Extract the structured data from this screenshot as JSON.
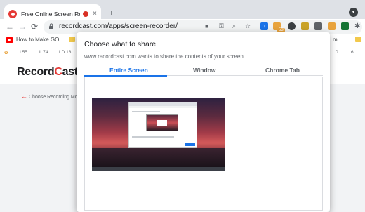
{
  "browser": {
    "tab": {
      "title": "Free Online Screen Recorder",
      "close": "×"
    },
    "new_tab": "+",
    "url": "recordcast.com/apps/screen-recorder/",
    "nav": {
      "back": "←",
      "forward": "→",
      "reload": "⟳"
    },
    "extension_badge": "53",
    "profile_menu": "⋮"
  },
  "bookmarks": [
    {
      "label": "How to Make GO..."
    }
  ],
  "pagebar_items": [
    "I 55",
    "L 74",
    "LD 18",
    "0",
    "6"
  ],
  "page": {
    "logo_pre": "Record",
    "logo_c": "C",
    "logo_post": "ast",
    "back_link": "Choose Recording Mo"
  },
  "dialog": {
    "title": "Choose what to share",
    "subtitle": "www.recordcast.com wants to share the contents of your screen.",
    "tabs": [
      "Entire Screen",
      "Window",
      "Chrome Tab"
    ],
    "active_tab": "Entire Screen"
  },
  "colors": {
    "accent": "#1a73e8",
    "brand": "#e53935"
  }
}
